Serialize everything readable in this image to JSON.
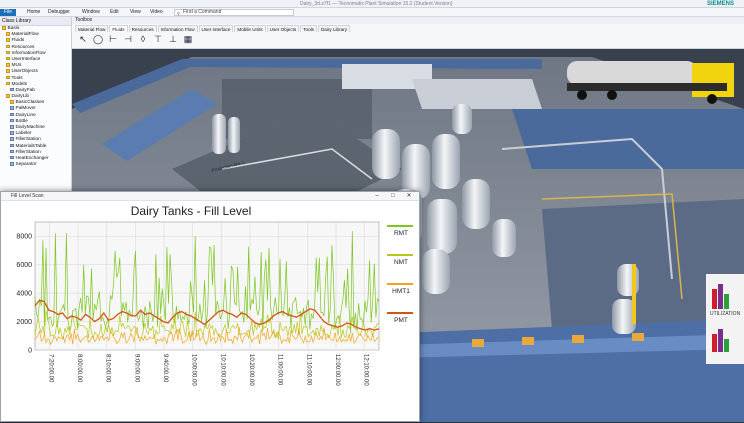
{
  "titlebar": {
    "text": "Dairy_3d.s7f1 — Tecnomatix Plant Simulation 15.2 (Student Version)",
    "brand": "SIEMENS"
  },
  "ribbon": {
    "tabs": [
      "File",
      "Home",
      "Debugger",
      "Window",
      "Edit",
      "View",
      "Video"
    ],
    "command_placeholder": "Find a Command"
  },
  "class_library": {
    "title": "Class Library",
    "items": [
      {
        "label": "Basis",
        "kind": "folder",
        "indent": 0
      },
      {
        "label": "MaterialFlow",
        "kind": "folder",
        "indent": 1
      },
      {
        "label": "Fluids",
        "kind": "folder",
        "indent": 1
      },
      {
        "label": "Resources",
        "kind": "folder",
        "indent": 1
      },
      {
        "label": "InformationFlow",
        "kind": "folder",
        "indent": 1
      },
      {
        "label": "UserInterface",
        "kind": "folder",
        "indent": 1
      },
      {
        "label": "MUs",
        "kind": "folder",
        "indent": 1
      },
      {
        "label": "UserObjects",
        "kind": "folder",
        "indent": 1
      },
      {
        "label": "Tools",
        "kind": "folder",
        "indent": 1
      },
      {
        "label": "Models",
        "kind": "folder",
        "indent": 1
      },
      {
        "label": "DairyFab",
        "kind": "object",
        "indent": 2
      },
      {
        "label": "DairyLib",
        "kind": "folder",
        "indent": 1
      },
      {
        "label": "BasicClasses",
        "kind": "folder",
        "indent": 2
      },
      {
        "label": "PalMover",
        "kind": "object",
        "indent": 2
      },
      {
        "label": "DairyLine",
        "kind": "object",
        "indent": 2
      },
      {
        "label": "Bottle",
        "kind": "object",
        "indent": 2
      },
      {
        "label": "DairyMachine",
        "kind": "object",
        "indent": 2
      },
      {
        "label": "Labeler",
        "kind": "object",
        "indent": 2
      },
      {
        "label": "FillerStation",
        "kind": "object",
        "indent": 2
      },
      {
        "label": "MaterialsTable",
        "kind": "object",
        "indent": 2
      },
      {
        "label": "FillerStation",
        "kind": "object",
        "indent": 2
      },
      {
        "label": "HeatExchanger",
        "kind": "object",
        "indent": 2
      },
      {
        "label": "Separator",
        "kind": "object",
        "indent": 2
      }
    ]
  },
  "toolbox": {
    "title": "Toolbox",
    "tabs": [
      "Material Flow",
      "Fluids",
      "Resources",
      "Information Flow",
      "User Interface",
      "Mobile Units",
      "User Objects",
      "Tools",
      "Dairy Library"
    ],
    "active_tab": 1
  },
  "scene": {
    "floor_label": "Production line 1",
    "side_label": "UTILIZATION"
  },
  "chart_window": {
    "title": "Fill Level Scan"
  },
  "chart_data": {
    "type": "line",
    "title": "Dairy Tanks - Fill Level",
    "xlabel": "",
    "ylabel": "",
    "ylim": [
      0,
      9000
    ],
    "yticks": [
      0,
      2000,
      4000,
      6000,
      8000
    ],
    "xticks": [
      "7:20:00.00",
      "8:00:00.00",
      "8:10:00.00",
      "9:00:00.00",
      "9:40:00.00",
      "10:00:00.00",
      "10:10:00.00",
      "10:20:00.00",
      "11:00:00.00",
      "11:10:00.00",
      "12:00:00.00",
      "12:10:00.00"
    ],
    "grid": true,
    "legend_position": "right",
    "series": [
      {
        "name": "RMT",
        "color": "#7cc61e",
        "baseline": 1800,
        "amplitude": 6200,
        "seed": 3
      },
      {
        "name": "NMT",
        "color": "#b9c91a",
        "baseline": 1200,
        "amplitude": 1200,
        "seed": 7
      },
      {
        "name": "HMT1",
        "color": "#f2a51a",
        "baseline": 600,
        "amplitude": 900,
        "seed": 11
      },
      {
        "name": "PMT",
        "color": "#d45512",
        "values": [
          3100,
          3500,
          3400,
          2800,
          2700,
          2500,
          2600,
          2200,
          2400,
          2300,
          2100,
          2500,
          2300,
          2000,
          2200,
          2600,
          2100,
          2200,
          2500,
          2700,
          2600,
          2400,
          2400,
          2800,
          2500,
          2600,
          2400,
          2200,
          2000,
          1900,
          2300,
          2600,
          2700,
          2500,
          2400,
          2200,
          2000,
          1800,
          2100,
          2400,
          2700,
          2800,
          2600,
          2500,
          2300,
          2600,
          2500,
          2200,
          1900,
          1800,
          1900,
          2100,
          2400,
          2600,
          2700,
          2500,
          2400,
          2300,
          2500,
          2700,
          2900,
          2800,
          2400,
          2000,
          1800,
          1700,
          1600,
          1700,
          1900,
          1800,
          1600,
          1500,
          1400,
          1500,
          1400,
          1500
        ]
      }
    ]
  }
}
